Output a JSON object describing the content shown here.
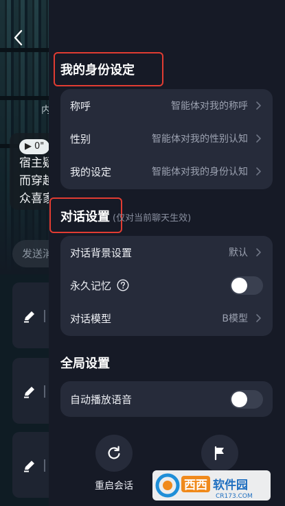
{
  "background": {
    "inner_label": "内",
    "voice_duration": "0\"",
    "bubble_lines": [
      "宿主疑",
      "而穿越",
      "众喜家"
    ],
    "send_placeholder": "发送消"
  },
  "identity": {
    "title": "我的身份设定",
    "rows": [
      {
        "label": "称呼",
        "value": "智能体对我的称呼"
      },
      {
        "label": "性别",
        "value": "智能体对我的性别认知"
      },
      {
        "label": "我的设定",
        "value": "智能体对我的身份认知"
      }
    ]
  },
  "dialog": {
    "title": "对话设置",
    "note": "(仅对当前聊天生效)",
    "background_setting": {
      "label": "对话背景设置",
      "value": "默认"
    },
    "memory": {
      "label": "永久记忆",
      "enabled": false
    },
    "model": {
      "label": "对话模型",
      "value": "B模型"
    }
  },
  "global": {
    "title": "全局设置",
    "autoplay": {
      "label": "自动播放语音",
      "enabled": false
    }
  },
  "actions": {
    "restart_label": "重启会话",
    "report_label": ""
  },
  "watermark": {
    "text": "西西软件园",
    "domain": "CR173.COM"
  },
  "colors": {
    "highlight": "#e23c32",
    "drawer_bg": "#161a26",
    "card_bg": "#262b3a"
  }
}
